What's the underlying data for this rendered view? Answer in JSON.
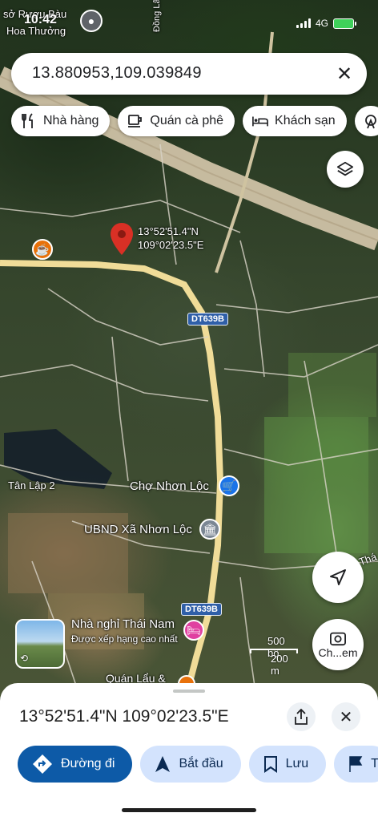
{
  "status_bar": {
    "time": "10:42",
    "network": "4G"
  },
  "search": {
    "query": "13.880953,109.039849"
  },
  "chips": [
    {
      "label": "Nhà hàng",
      "icon": "fork-knife-icon"
    },
    {
      "label": "Quán cà phê",
      "icon": "coffee-cup-icon"
    },
    {
      "label": "Khách sạn",
      "icon": "bed-icon"
    }
  ],
  "map": {
    "place_labels": {
      "top_left_1": "sở Rượu Bàu",
      "top_left_2": "Hoa Thưởng",
      "road_vertical": "Đồng Lâm",
      "tan_lap": "Tân Lập 2",
      "market": "Chợ Nhơn Lộc",
      "ubnd": "UBND Xã Nhơn Lộc",
      "guesthouse": "Nhà nghỉ Thái Nam",
      "guesthouse_sub": "Được xếp hạng cao nhất",
      "restaurant": "Quán Lẩu &",
      "road_right": "Thá"
    },
    "pin": {
      "lat": "13°52'51.4\"N",
      "lng": "109°02'23.5\"E"
    },
    "road_badges": [
      "DT639B",
      "DT639B"
    ],
    "scale": {
      "feet": "500 bộ",
      "meters": "200 m"
    },
    "explore_label": "Ch...em"
  },
  "sheet": {
    "title": "13°52'51.4\"N 109°02'23.5\"E",
    "actions": [
      {
        "label": "Đường đi",
        "icon": "directions-icon"
      },
      {
        "label": "Bắt đầu",
        "icon": "navigation-arrow-icon"
      },
      {
        "label": "Lưu",
        "icon": "bookmark-icon"
      },
      {
        "label": "T",
        "icon": "flag-icon"
      }
    ]
  },
  "colors": {
    "primary": "#0d5aa7",
    "secondary": "#d3e3fd",
    "pin": "#d93025",
    "road": "#e8d08c"
  }
}
